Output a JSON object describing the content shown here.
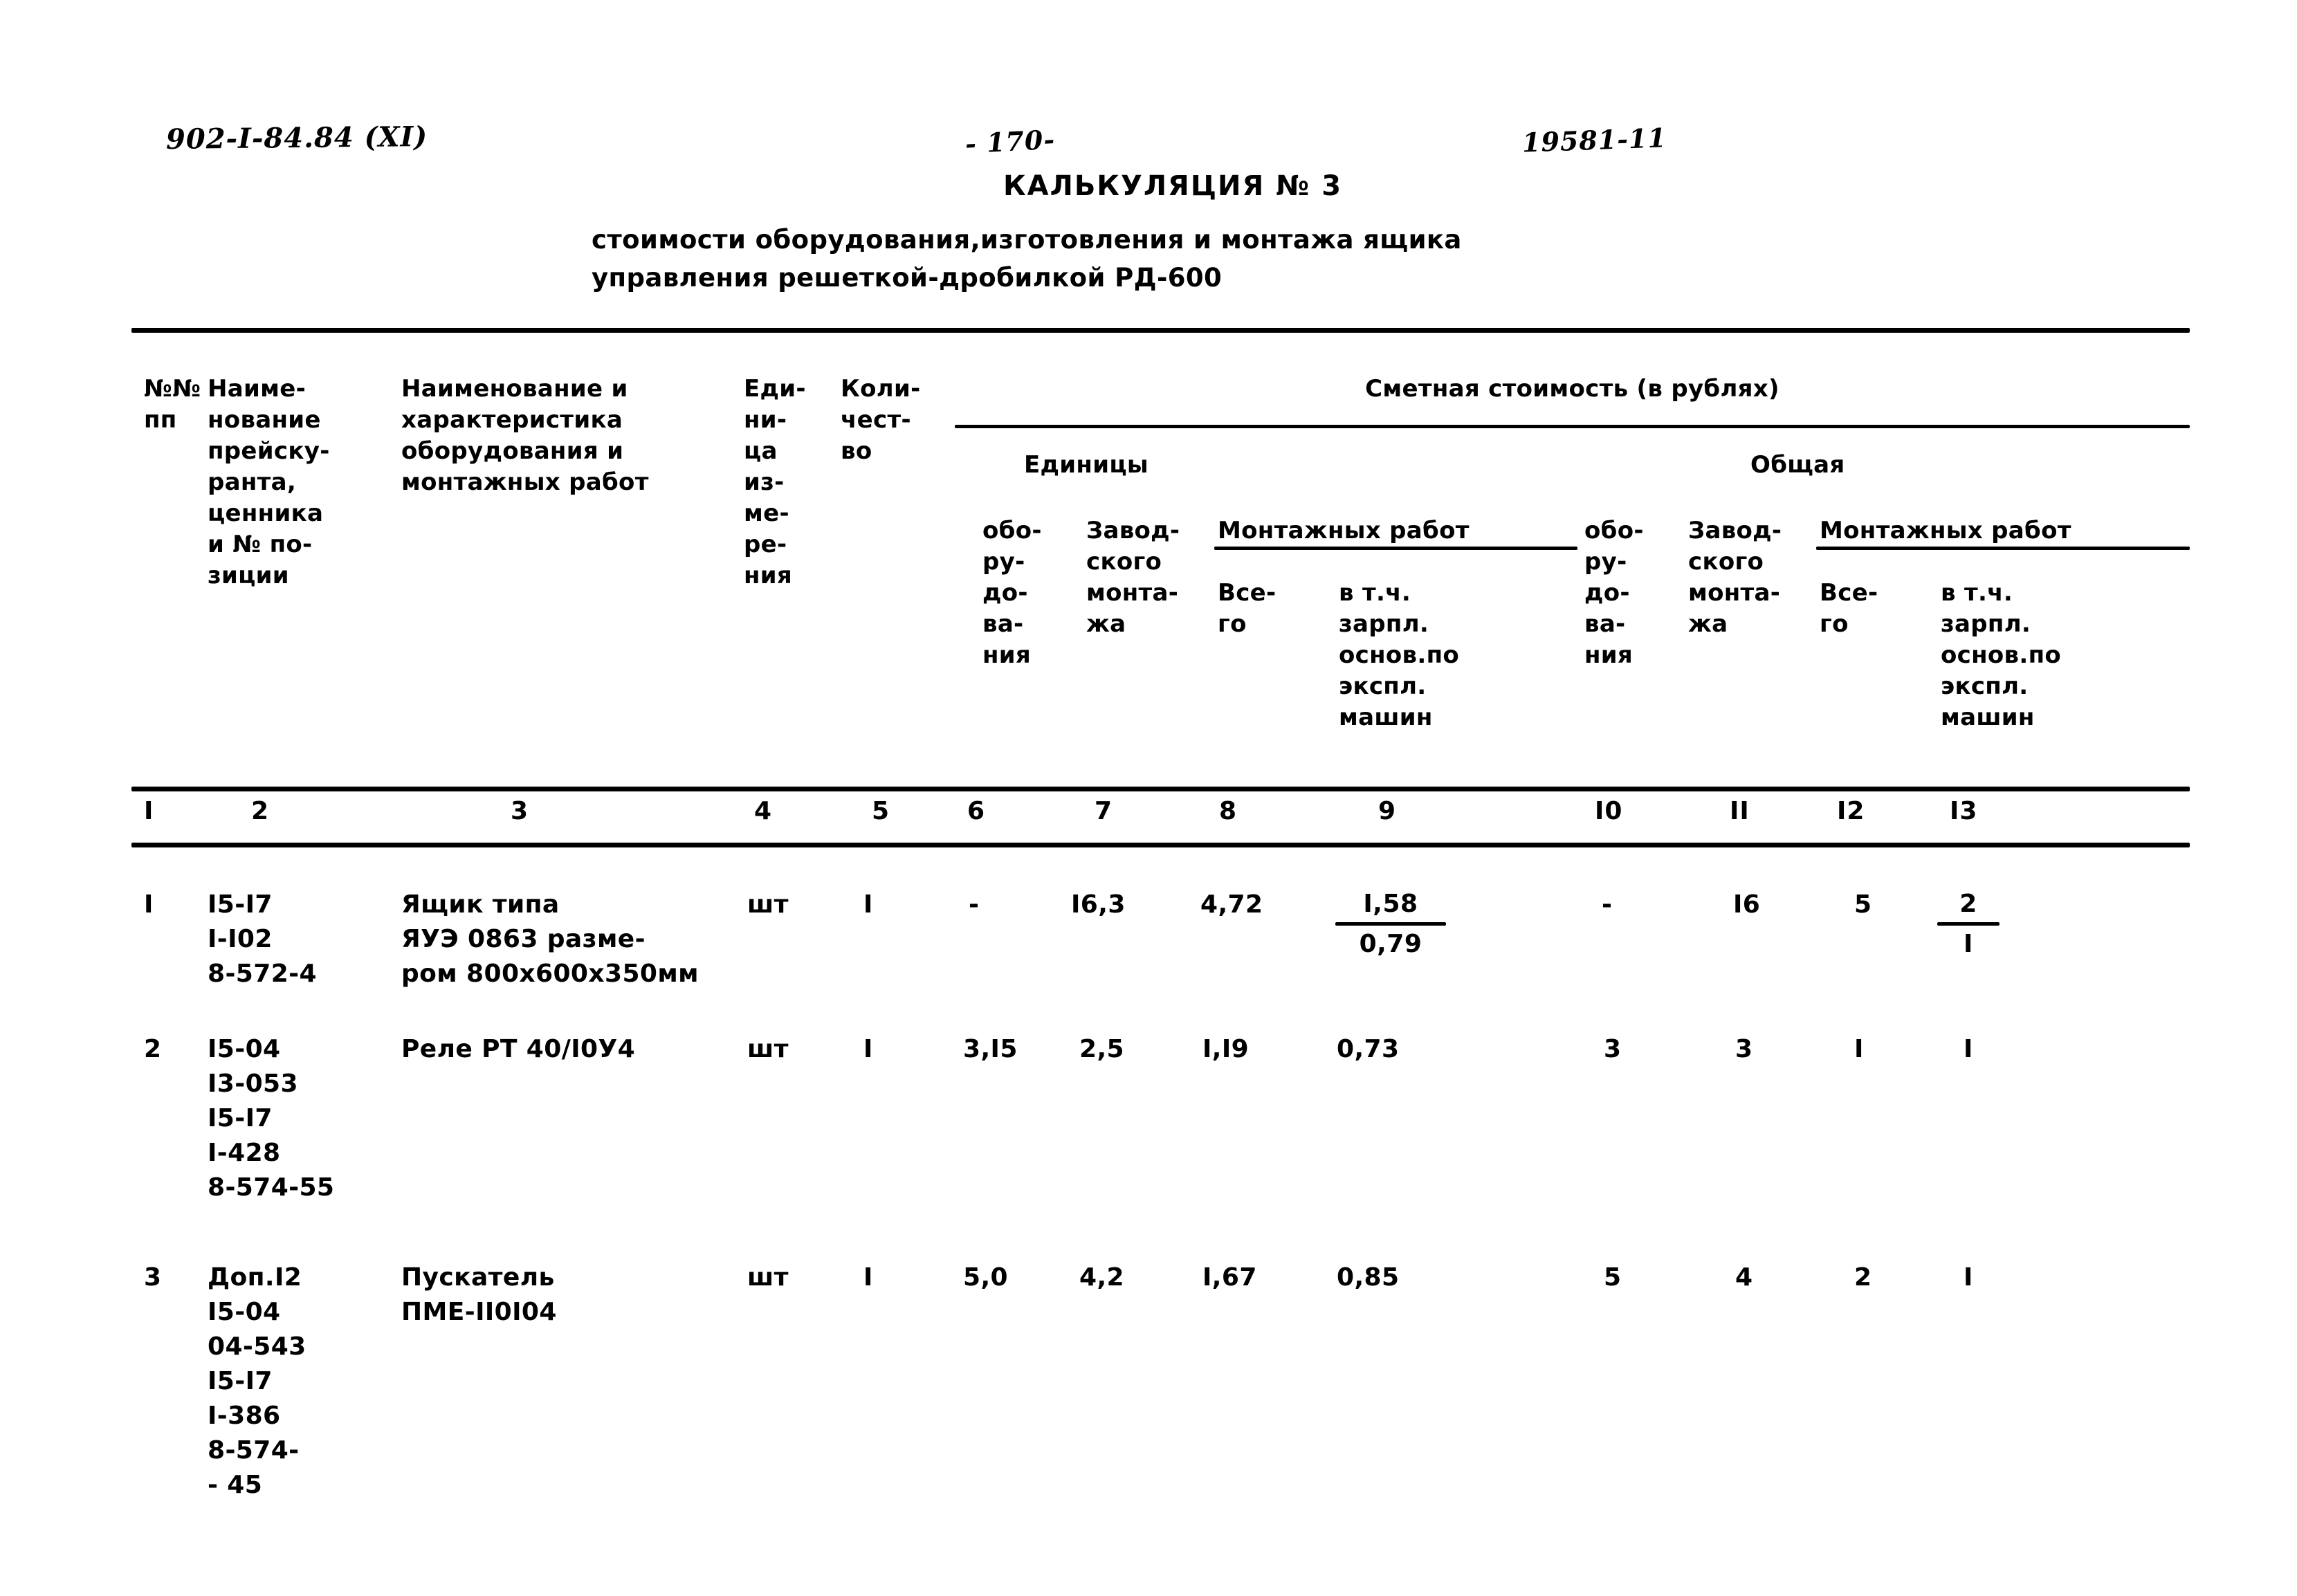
{
  "header": {
    "doc_code": "902-I-84.84 (XI)",
    "page_number": "- 170-",
    "stamp_number": "19581-11"
  },
  "title": {
    "main": "КАЛЬКУЛЯЦИЯ № 3",
    "subtitle_line1": "стоимости оборудования,изготовления и монтажа ящика",
    "subtitle_line2": "управления решеткой-дробилкой  РД-600"
  },
  "table": {
    "headers": {
      "col1": "№№\nпп",
      "col2": "Наиме-\nнование\nпрейску-\nранта,\nценника\nи № по-\nзиции",
      "col3": "Наименование и\nхарактеристика\nоборудования и\nмонтажных работ",
      "col4": "Еди-\nни-\nца\nиз-\nме-\nре-\nния",
      "col5": "Коли-\nчест-\nво",
      "group_cost": "Сметная стоимость (в рублях)",
      "group_unit": "Единицы",
      "group_total": "Общая",
      "col6": "обо-\nру-\nдо-\nва-\nния",
      "col7": "Завод-\nского\nмонта-\nжа",
      "group_install_unit": "Монтажных работ",
      "col8": "Все-\nго",
      "col9": "в т.ч.\nзарпл.\nоснов.по\nэкспл.\nмашин",
      "col10": "обо-\nру-\nдо-\nва-\nния",
      "col11": "Завод-\nского\nмонта-\nжа",
      "group_install_total": "Монтажных работ",
      "col12": "Все-\nго",
      "col13": "в т.ч.\nзарпл.\nоснов.по\nэкспл.\nмашин"
    },
    "column_numbers": [
      "I",
      "2",
      "3",
      "4",
      "5",
      "6",
      "7",
      "8",
      "9",
      "I0",
      "II",
      "I2",
      "I3"
    ],
    "rows": [
      {
        "no": "I",
        "price_list": "I5-I7\nI-I02\n8-572-4",
        "name": "Ящик типа\nЯУЭ 0863 разме-\nром 800х600х350мм",
        "unit": "шт",
        "qty": "I",
        "unit_equipment": "-",
        "unit_factory_assembly": "I6,3",
        "unit_install_total": "4,72",
        "unit_install_wages_top": "I,58",
        "unit_install_wages_bottom": "0,79",
        "total_equipment": "-",
        "total_factory_assembly": "I6",
        "total_install_total": "5",
        "total_install_wages_top": "2",
        "total_install_wages_bottom": "I"
      },
      {
        "no": "2",
        "price_list": "I5-04\nI3-053\nI5-I7\nI-428\n8-574-55",
        "name": "Реле РТ 40/I0У4",
        "unit": "шт",
        "qty": "I",
        "unit_equipment": "3,I5",
        "unit_factory_assembly": "2,5",
        "unit_install_total": "I,I9",
        "unit_install_wages": "0,73",
        "total_equipment": "3",
        "total_factory_assembly": "3",
        "total_install_total": "I",
        "total_install_wages": "I"
      },
      {
        "no": "3",
        "price_list": "Доп.I2\nI5-04\n04-543\nI5-I7\nI-386\n8-574-\n- 45",
        "name": "Пускатель\nПМЕ-II0I04",
        "unit": "шт",
        "qty": "I",
        "unit_equipment": "5,0",
        "unit_factory_assembly": "4,2",
        "unit_install_total": "I,67",
        "unit_install_wages": "0,85",
        "total_equipment": "5",
        "total_factory_assembly": "4",
        "total_install_total": "2",
        "total_install_wages": "I"
      }
    ]
  }
}
